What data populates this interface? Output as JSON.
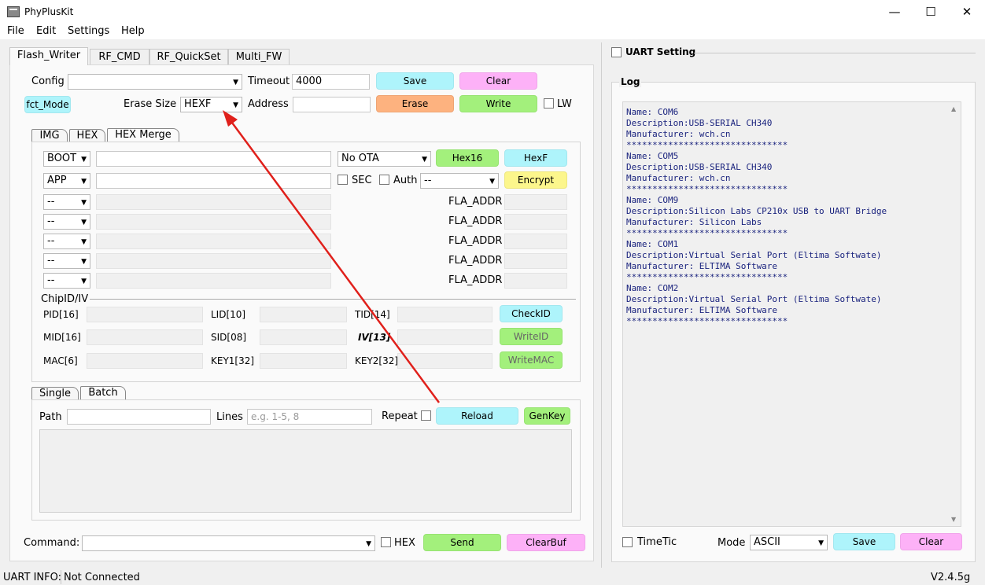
{
  "window": {
    "title": "PhyPlusKit",
    "minimize": "—",
    "maximize": "☐",
    "close": "✕"
  },
  "menu": [
    "File",
    "Edit",
    "Settings",
    "Help"
  ],
  "tabs": [
    "Flash_Writer",
    "RF_CMD",
    "RF_QuickSet",
    "Multi_FW"
  ],
  "config": {
    "config_label": "Config",
    "config_value": "",
    "timeout_label": "Timeout",
    "timeout_value": "4000",
    "save": "Save",
    "clear": "Clear",
    "fct_mode": "fct_Mode",
    "erase_size_label": "Erase Size",
    "erase_size_value": "HEXF",
    "address_label": "Address",
    "address_value": "",
    "erase": "Erase",
    "write": "Write",
    "lw": "LW"
  },
  "subtabs": [
    "IMG",
    "HEX",
    "HEX Merge"
  ],
  "hexmerge": {
    "row1_sel": "BOOT",
    "ota_sel": "No OTA",
    "hex16": "Hex16",
    "hexf": "HexF",
    "row2_sel": "APP",
    "sec": "SEC",
    "auth": "Auth",
    "auth_sel": "--",
    "encrypt": "Encrypt",
    "dash": "--",
    "fla_addr": "FLA_ADDR"
  },
  "chipid": {
    "title": "ChipID/IV",
    "pid": "PID[16]",
    "lid": "LID[10]",
    "tid": "TID[14]",
    "checkid": "CheckID",
    "mid": "MID[16]",
    "sid": "SID[08]",
    "iv": "IV[13]",
    "writeid": "WriteID",
    "mac": "MAC[6]",
    "key1": "KEY1[32]",
    "key2": "KEY2[32]",
    "writemac": "WriteMAC"
  },
  "batch_tabs": [
    "Single",
    "Batch"
  ],
  "batch": {
    "path_label": "Path",
    "lines_label": "Lines",
    "lines_placeholder": "e.g. 1-5, 8",
    "repeat_label": "Repeat",
    "reload": "Reload",
    "genkey": "GenKey"
  },
  "command": {
    "label": "Command:",
    "hex": "HEX",
    "send": "Send",
    "clearbuf": "ClearBuf"
  },
  "uart": {
    "title": "UART Setting"
  },
  "log": {
    "title": "Log",
    "lines": [
      "Name: COM6",
      "Description:USB-SERIAL CH340",
      "Manufacturer: wch.cn",
      "*******************************",
      "Name: COM5",
      "Description:USB-SERIAL CH340",
      "Manufacturer: wch.cn",
      "*******************************",
      "Name: COM9",
      "Description:Silicon Labs CP210x USB to UART Bridge",
      "Manufacturer: Silicon Labs",
      "*******************************",
      "Name: COM1",
      "Description:Virtual Serial Port (Eltima Softwate)",
      "Manufacturer: ELTIMA Software",
      "*******************************",
      "Name: COM2",
      "Description:Virtual Serial Port (Eltima Softwate)",
      "Manufacturer: ELTIMA Software",
      "*******************************"
    ],
    "timetic": "TimeTic",
    "mode_label": "Mode",
    "mode_value": "ASCII",
    "save": "Save",
    "clear": "Clear"
  },
  "status": {
    "label": "UART INFO:",
    "value": "Not Connected",
    "version": "V2.4.5g"
  },
  "colors": {
    "cyan": "#aef4fb",
    "pink": "#fdb1f7",
    "orange": "#fdb27f",
    "green": "#a3f07c",
    "yellow": "#fcf68c",
    "annotation_arrow": "#e0201b"
  }
}
